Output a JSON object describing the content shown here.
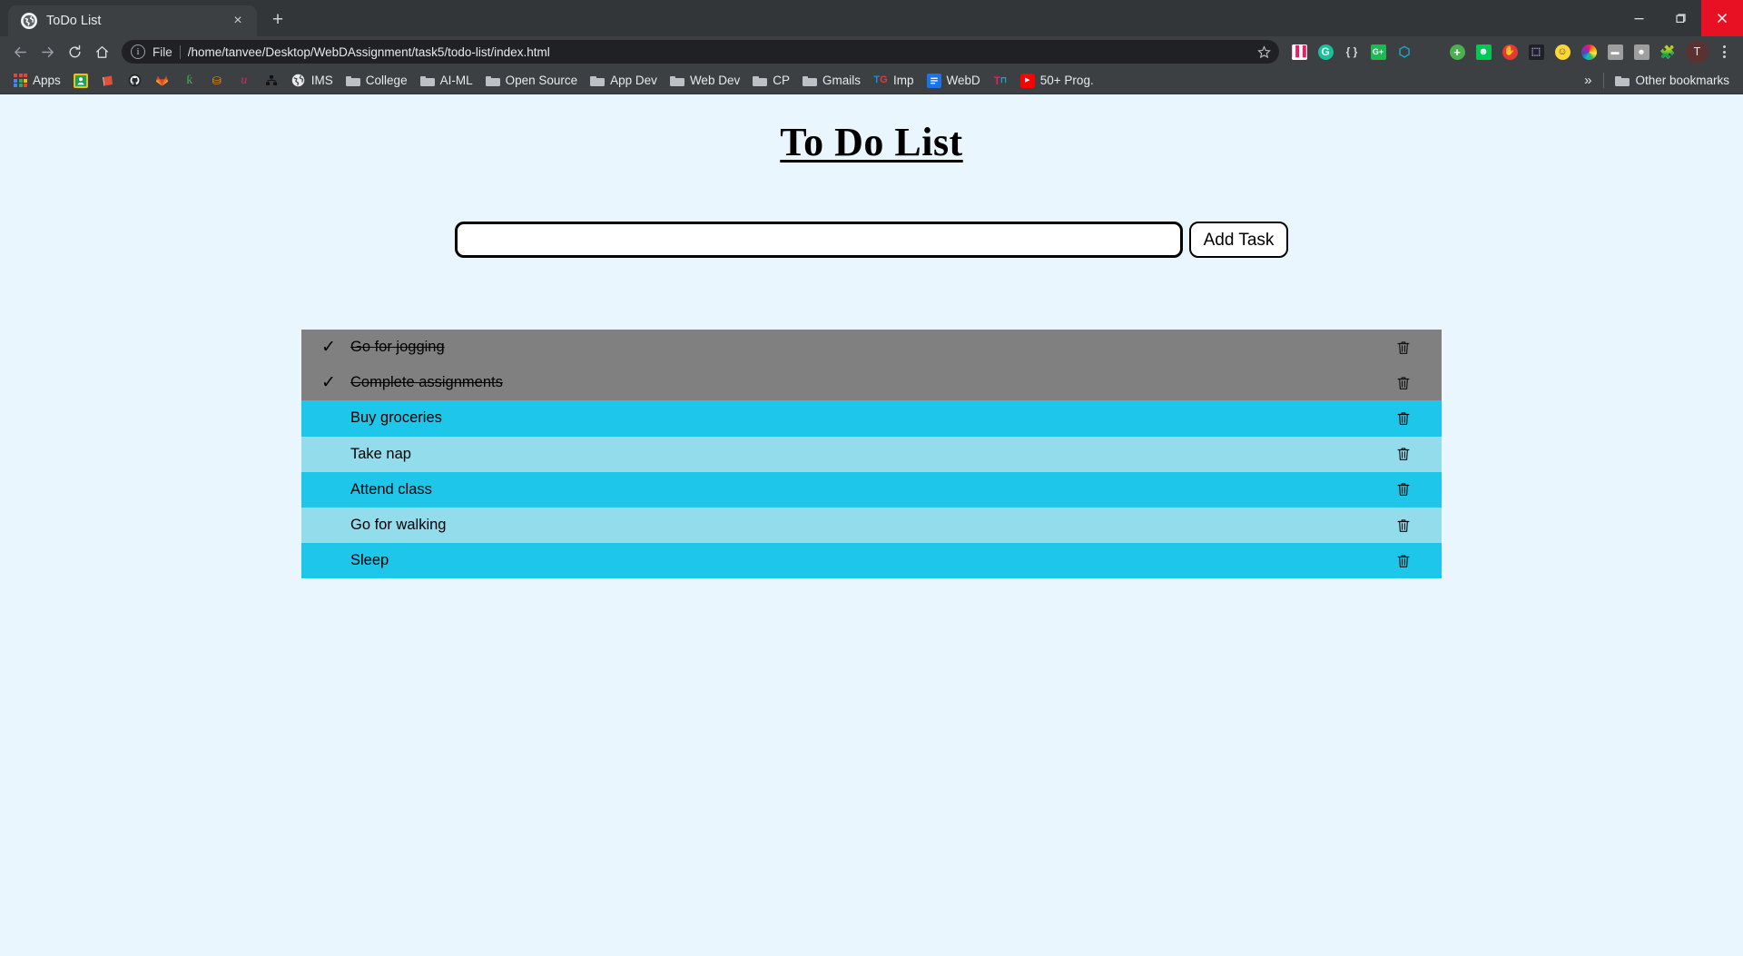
{
  "browser": {
    "tab": {
      "title": "ToDo List",
      "favicon": "globe-icon",
      "close": "×"
    },
    "new_tab": "+",
    "window_controls": {
      "minimize": "minimize-icon",
      "maximize": "maximize-icon",
      "close": "close-icon"
    },
    "nav": {
      "back": "←",
      "forward": "→",
      "reload": "↻",
      "home": "⌂"
    },
    "omnibox": {
      "info": "i",
      "scheme_label": "File",
      "url": "/home/tanvee/Desktop/WebDAssignment/task5/todo-list/index.html",
      "star": "☆"
    },
    "extensions": [
      {
        "name": "bar-chart-extension",
        "glyph": "▐▐",
        "bg": "#ffffff",
        "fg": "#e91e63"
      },
      {
        "name": "grammarly-extension",
        "glyph": "G",
        "bg": "#15c39a",
        "fg": "#ffffff"
      },
      {
        "name": "json-viewer-extension",
        "glyph": "{ }",
        "bg": "#3c4043",
        "fg": "#d6d8da"
      },
      {
        "name": "google-plus-extension",
        "glyph": "G+",
        "bg": "#1db954",
        "fg": "#ffffff"
      },
      {
        "name": "hexagon-extension",
        "glyph": "⬡",
        "bg": "#3c4043",
        "fg": "#1ba6c4"
      },
      {
        "name": "color-squares-extension",
        "glyph": "",
        "bg": "#9c27b0",
        "fg": "#ffffff"
      },
      {
        "name": "add-plus-extension",
        "glyph": "+",
        "bg": "#4caf50",
        "fg": "#ffffff"
      },
      {
        "name": "smiley-green-extension",
        "glyph": "☺",
        "bg": "#00c853",
        "fg": "#ffffff"
      },
      {
        "name": "stop-hand-extension",
        "glyph": "✋",
        "bg": "#e53935",
        "fg": "#ffffff"
      },
      {
        "name": "screenshot-extension",
        "glyph": "▣",
        "bg": "#202124",
        "fg": "#b0a8f0"
      },
      {
        "name": "emoji-extension",
        "glyph": "☻",
        "bg": "#fdd835",
        "fg": "#5d4037"
      },
      {
        "name": "color-wheel-extension",
        "glyph": "✸",
        "bg": "#3c4043",
        "fg": "#e91e63"
      },
      {
        "name": "device-gray-extension",
        "glyph": "▬",
        "bg": "#9e9e9e",
        "fg": "#ffffff"
      },
      {
        "name": "robot-gray-extension",
        "glyph": "■",
        "bg": "#9e9e9e",
        "fg": "#ffffff"
      },
      {
        "name": "puzzle-extensions-icon",
        "glyph": "❖",
        "bg": "#3c4043",
        "fg": "#e8eaed"
      }
    ],
    "profile_initial": "T",
    "menu": "kebab-menu-icon",
    "bookmarks": [
      {
        "label": "Apps",
        "icon": "apps-grid-icon",
        "type": "apps"
      },
      {
        "label": "",
        "icon": "contacts-icon",
        "type": "icon",
        "bg": "#1aa260",
        "fg": "#ffffff",
        "glyph": "☺"
      },
      {
        "label": "",
        "icon": "books-icon",
        "type": "icon",
        "bg": "#e0503a",
        "fg": "#ffffff",
        "glyph": "▤"
      },
      {
        "label": "",
        "icon": "github-icon",
        "type": "icon",
        "bg": "#24292e",
        "fg": "#ffffff",
        "glyph": "●"
      },
      {
        "label": "",
        "icon": "gitlab-icon",
        "type": "icon",
        "bg": "#3c4043",
        "fg": "#e24329",
        "glyph": "▲"
      },
      {
        "label": "",
        "icon": "green-script-icon",
        "type": "icon",
        "bg": "#3c4043",
        "fg": "#4caf50",
        "glyph": "✡"
      },
      {
        "label": "",
        "icon": "orange-app-icon",
        "type": "icon",
        "bg": "#3c4043",
        "fg": "#ff8f00",
        "glyph": "☰"
      },
      {
        "label": "",
        "icon": "unacademy-icon",
        "type": "icon",
        "bg": "#3c4043",
        "fg": "#e91e63",
        "glyph": "u"
      },
      {
        "label": "",
        "icon": "black-square-icon",
        "type": "icon",
        "bg": "#3c4043",
        "fg": "#111111",
        "glyph": "▪"
      },
      {
        "label": "IMS",
        "icon": "globe-icon",
        "type": "icon",
        "bg": "#f1f3f4",
        "fg": "#3c4043",
        "glyph": "⊕"
      },
      {
        "label": "College",
        "icon": "folder-icon",
        "type": "folder"
      },
      {
        "label": "AI-ML",
        "icon": "folder-icon",
        "type": "folder"
      },
      {
        "label": "Open Source",
        "icon": "folder-icon",
        "type": "folder"
      },
      {
        "label": "App Dev",
        "icon": "folder-icon",
        "type": "folder"
      },
      {
        "label": "Web Dev",
        "icon": "folder-icon",
        "type": "folder"
      },
      {
        "label": "CP",
        "icon": "folder-icon",
        "type": "folder"
      },
      {
        "label": "Gmails",
        "icon": "folder-icon",
        "type": "folder"
      },
      {
        "label": "Imp",
        "icon": "tg-icon",
        "type": "icon",
        "bg": "#3c4043",
        "fg": "#1e88e5",
        "glyph": "TG"
      },
      {
        "label": "WebD",
        "icon": "doc-icon",
        "type": "icon",
        "bg": "#1a73e8",
        "fg": "#ffffff",
        "glyph": "≡"
      },
      {
        "label": "",
        "icon": "magenta-t-icon",
        "type": "icon",
        "bg": "#3c4043",
        "fg": "#e91e63",
        "glyph": "T"
      },
      {
        "label": "50+ Prog.",
        "icon": "youtube-icon",
        "type": "icon",
        "bg": "#ff0000",
        "fg": "#ffffff",
        "glyph": "▶"
      }
    ],
    "bookmarks_overflow": "»",
    "other_bookmarks": {
      "label": "Other bookmarks",
      "icon": "folder-icon"
    }
  },
  "page": {
    "title": "To Do List",
    "input": {
      "value": "",
      "placeholder": ""
    },
    "add_button": "Add Task",
    "trash_icon": "trash-icon",
    "check_icon": "✓",
    "colors": {
      "background": "#e9f6fe",
      "completed_row": "#808080",
      "row_odd": "#1ec7e9",
      "row_even": "#92dcec"
    },
    "tasks": [
      {
        "label": "Go for jogging",
        "completed": true
      },
      {
        "label": "Complete assignments",
        "completed": true
      },
      {
        "label": "Buy groceries",
        "completed": false
      },
      {
        "label": "Take nap",
        "completed": false
      },
      {
        "label": "Attend class",
        "completed": false
      },
      {
        "label": "Go for walking",
        "completed": false
      },
      {
        "label": "Sleep",
        "completed": false
      }
    ]
  }
}
